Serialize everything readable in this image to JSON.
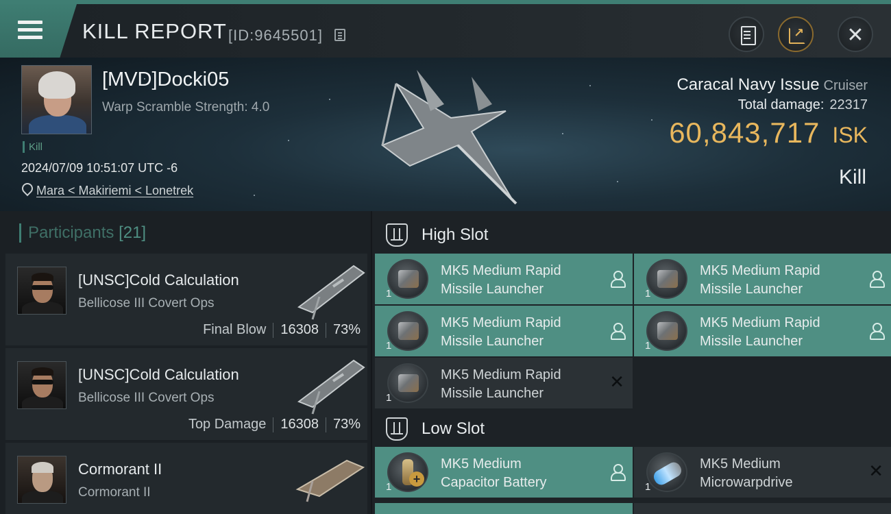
{
  "header": {
    "title": "KILL REPORT",
    "report_id": "[ID:9645501]"
  },
  "victim": {
    "name": "[MVD]Docki05",
    "scramble": "Warp Scramble Strength: 4.0",
    "tag": "Kill",
    "datetime": "2024/07/09 10:51:07 UTC -6",
    "location": "Mara < Makiriemi < Lonetrek",
    "ship_name": "Caracal Navy Issue",
    "ship_class": "Cruiser",
    "total_damage_label": "Total damage:",
    "total_damage": "22317",
    "isk_value": "60,843,717",
    "isk_currency": "ISK",
    "result": "Kill"
  },
  "participants": {
    "label": "Participants",
    "count": "[21]",
    "items": [
      {
        "name": "[UNSC]Cold Calculation",
        "ship": "Bellicose III Covert Ops",
        "role": "Final Blow",
        "damage": "16308",
        "percent": "73%"
      },
      {
        "name": "[UNSC]Cold Calculation",
        "ship": "Bellicose III Covert Ops",
        "role": "Top Damage",
        "damage": "16308",
        "percent": "73%"
      },
      {
        "name": "Cormorant II",
        "ship": "Cormorant II"
      }
    ]
  },
  "slots": {
    "high_label": "High Slot",
    "low_label": "Low Slot",
    "high": [
      {
        "line1": "MK5 Medium Rapid",
        "line2": "Missile Launcher",
        "qty": "1",
        "status": "person"
      },
      {
        "line1": "MK5 Medium Rapid",
        "line2": "Missile Launcher",
        "qty": "1",
        "status": "person"
      },
      {
        "line1": "MK5 Medium Rapid",
        "line2": "Missile Launcher",
        "qty": "1",
        "status": "person"
      },
      {
        "line1": "MK5 Medium Rapid",
        "line2": "Missile Launcher",
        "qty": "1",
        "status": "person"
      },
      {
        "line1": "MK5 Medium Rapid",
        "line2": "Missile Launcher",
        "qty": "1",
        "status": "destroyed"
      }
    ],
    "low": [
      {
        "line1": "MK5 Medium",
        "line2": "Capacitor Battery",
        "qty": "1",
        "status": "person"
      },
      {
        "line1": "MK5 Medium",
        "line2": "Microwarpdrive",
        "qty": "1",
        "status": "destroyed"
      }
    ]
  },
  "colors": {
    "accent_teal": "#4f8f83",
    "isk_gold": "#e8b75d",
    "background": "#14181c"
  },
  "icons": [
    "menu-icon",
    "copy-icon",
    "notes-icon",
    "share-icon",
    "close-icon",
    "location-pin-icon",
    "slot-icon",
    "person-icon",
    "x-icon"
  ]
}
